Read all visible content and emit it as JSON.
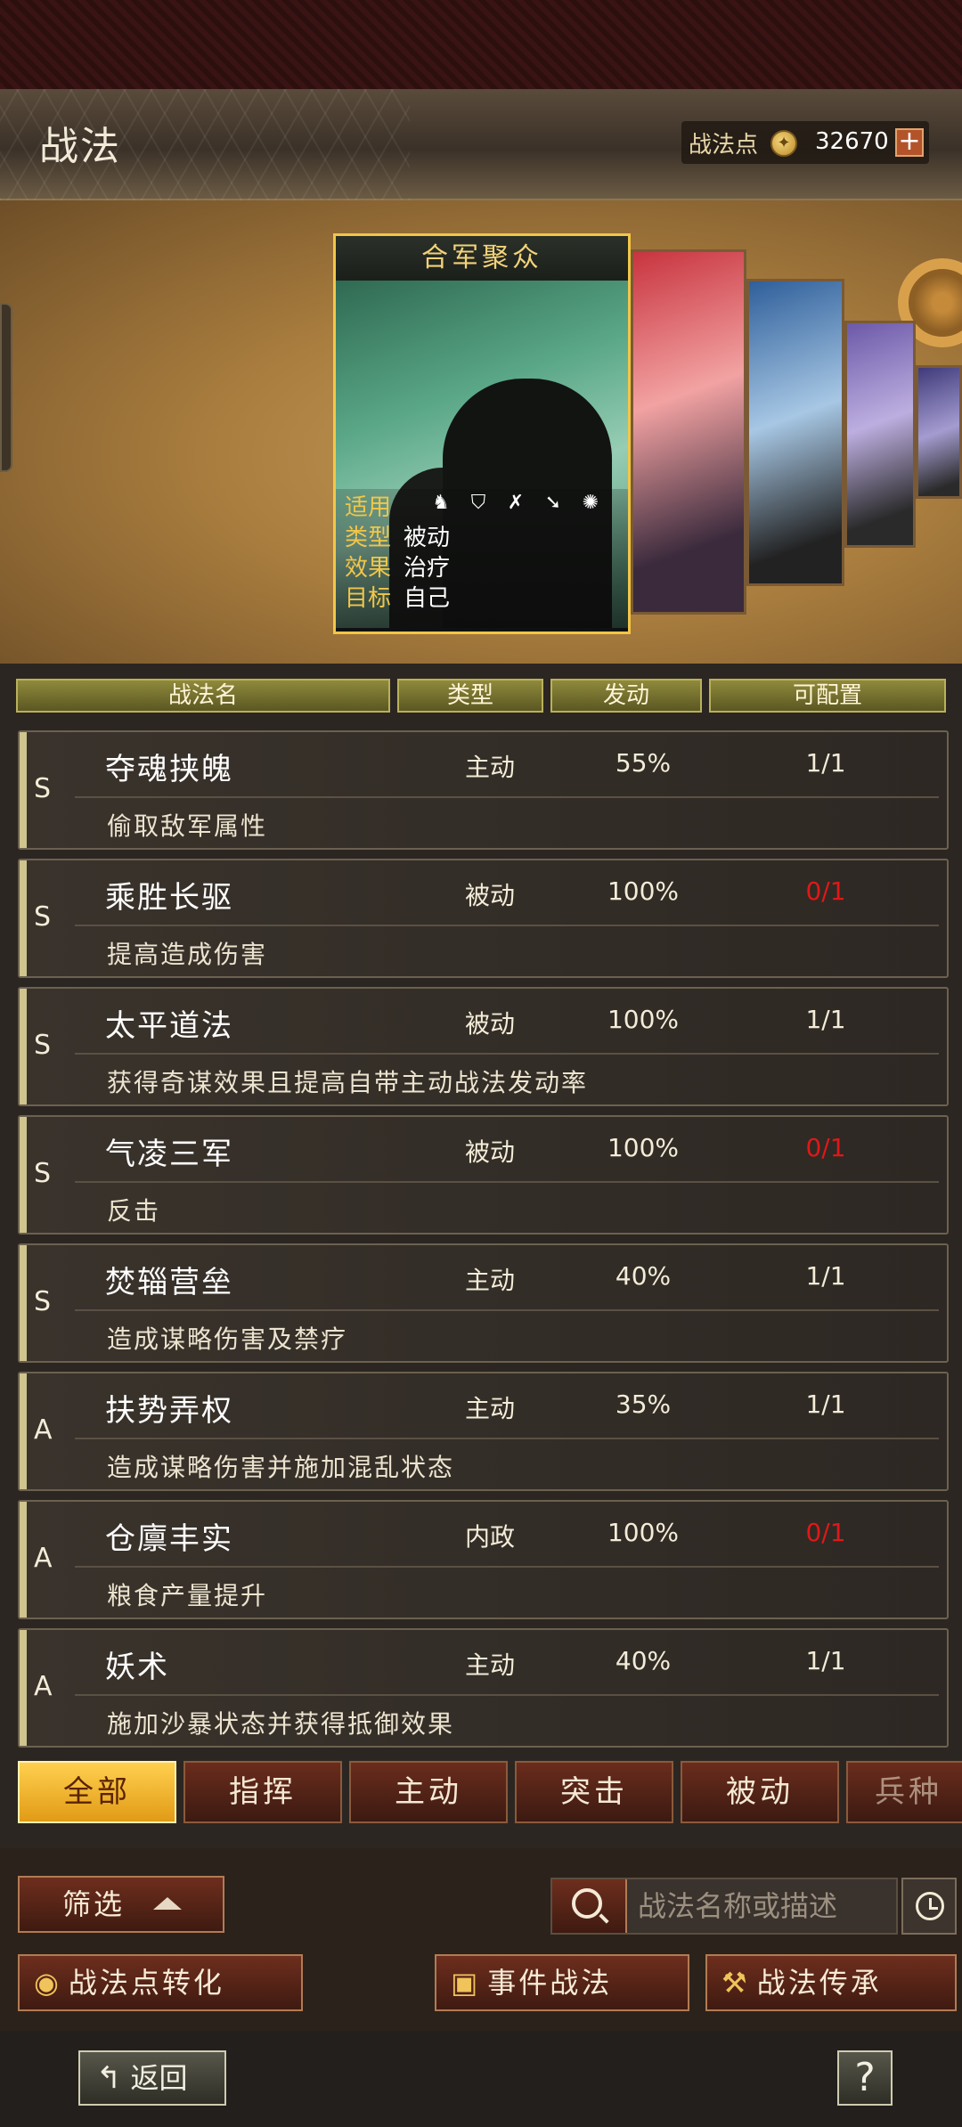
{
  "header": {
    "title": "战法",
    "points_label": "战法点",
    "points_value": "32670",
    "plus": "+"
  },
  "featured_card": {
    "name": "合军聚众",
    "applicable_label": "适用",
    "type_label": "类型",
    "type_value": "被动",
    "effect_label": "效果",
    "effect_value": "治疗",
    "target_label": "目标",
    "target_value": "自己",
    "unit_icons": [
      "cavalry-icon",
      "shield-icon",
      "bow-icon",
      "spear-icon",
      "siege-icon"
    ]
  },
  "table": {
    "headers": {
      "name": "战法名",
      "type": "类型",
      "trigger": "发动",
      "configurable": "可配置"
    },
    "rows": [
      {
        "grade": "S",
        "name": "夺魂挟魄",
        "type": "主动",
        "rate": "55%",
        "slots": "1/1",
        "slots_red": false,
        "desc": "偷取敌军属性"
      },
      {
        "grade": "S",
        "name": "乘胜长驱",
        "type": "被动",
        "rate": "100%",
        "slots": "0/1",
        "slots_red": true,
        "desc": "提高造成伤害"
      },
      {
        "grade": "S",
        "name": "太平道法",
        "type": "被动",
        "rate": "100%",
        "slots": "1/1",
        "slots_red": false,
        "desc": "获得奇谋效果且提高自带主动战法发动率"
      },
      {
        "grade": "S",
        "name": "气凌三军",
        "type": "被动",
        "rate": "100%",
        "slots": "0/1",
        "slots_red": true,
        "desc": "反击"
      },
      {
        "grade": "S",
        "name": "焚辎营垒",
        "type": "主动",
        "rate": "40%",
        "slots": "1/1",
        "slots_red": false,
        "desc": "造成谋略伤害及禁疗"
      },
      {
        "grade": "A",
        "name": "扶势弄权",
        "type": "主动",
        "rate": "35%",
        "slots": "1/1",
        "slots_red": false,
        "desc": "造成谋略伤害并施加混乱状态"
      },
      {
        "grade": "A",
        "name": "仓廪丰实",
        "type": "内政",
        "rate": "100%",
        "slots": "0/1",
        "slots_red": true,
        "desc": "粮食产量提升"
      },
      {
        "grade": "A",
        "name": "妖术",
        "type": "主动",
        "rate": "40%",
        "slots": "1/1",
        "slots_red": false,
        "desc": "施加沙暴状态并获得抵御效果"
      }
    ]
  },
  "tabs": [
    "全部",
    "指挥",
    "主动",
    "突击",
    "被动",
    "兵种"
  ],
  "active_tab": "全部",
  "controls": {
    "filter": "筛选",
    "search_placeholder": "战法名称或描述",
    "convert": "战法点转化",
    "event": "事件战法",
    "inherit": "战法传承"
  },
  "footer": {
    "back": "返回",
    "help": "?"
  },
  "colors": {
    "accent_gold": "#f2c648",
    "warning_red": "#e01818",
    "active_tab": "#ffd04f"
  }
}
